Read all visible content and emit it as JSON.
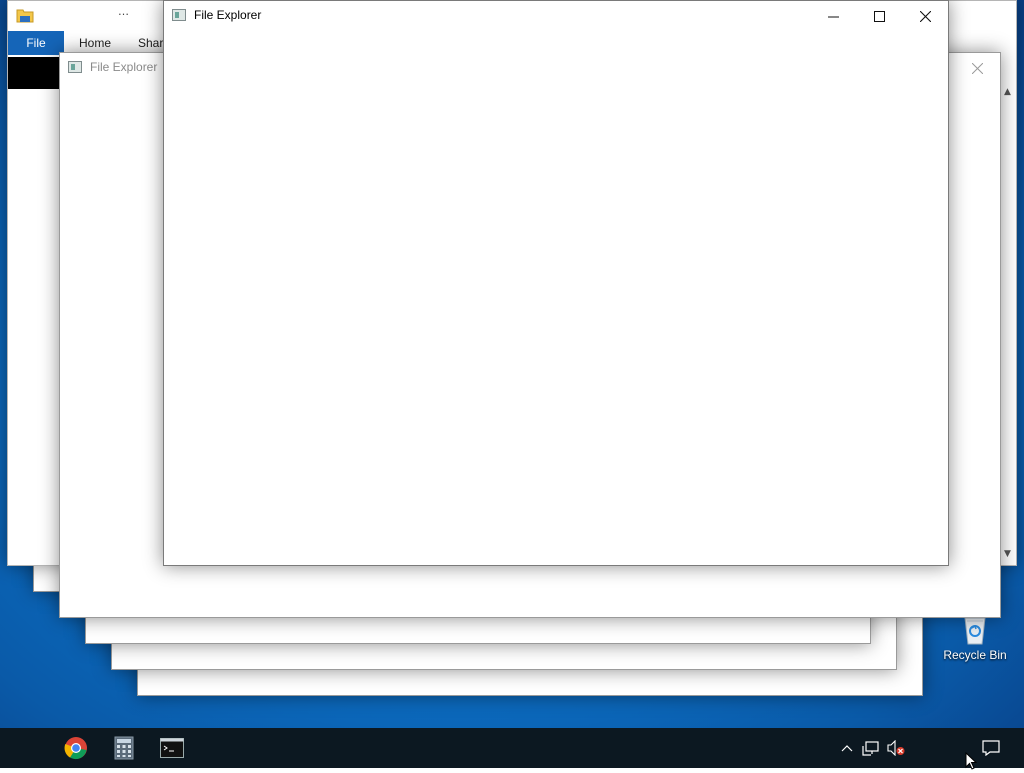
{
  "explorer_back": {
    "tabs": [
      "File",
      "Home",
      "Share"
    ],
    "title_partial": "…"
  },
  "windows": [
    {
      "title": "File Explorer",
      "state": "inactive"
    },
    {
      "title": "File Explorer",
      "state": "active"
    }
  ],
  "desktop": {
    "recycle_bin_label": "Recycle Bin"
  },
  "taskbar": {
    "apps": [
      "chrome-icon",
      "calculator-icon",
      "terminal-icon"
    ],
    "tray": [
      "show-hidden-icons-chevron",
      "network-icon",
      "volume-muted-icon",
      "action-center-icon"
    ]
  },
  "colors": {
    "desktop": "#0c72c9",
    "taskbar": "#0c1821",
    "ribbon_file_tab": "#1565b8"
  }
}
